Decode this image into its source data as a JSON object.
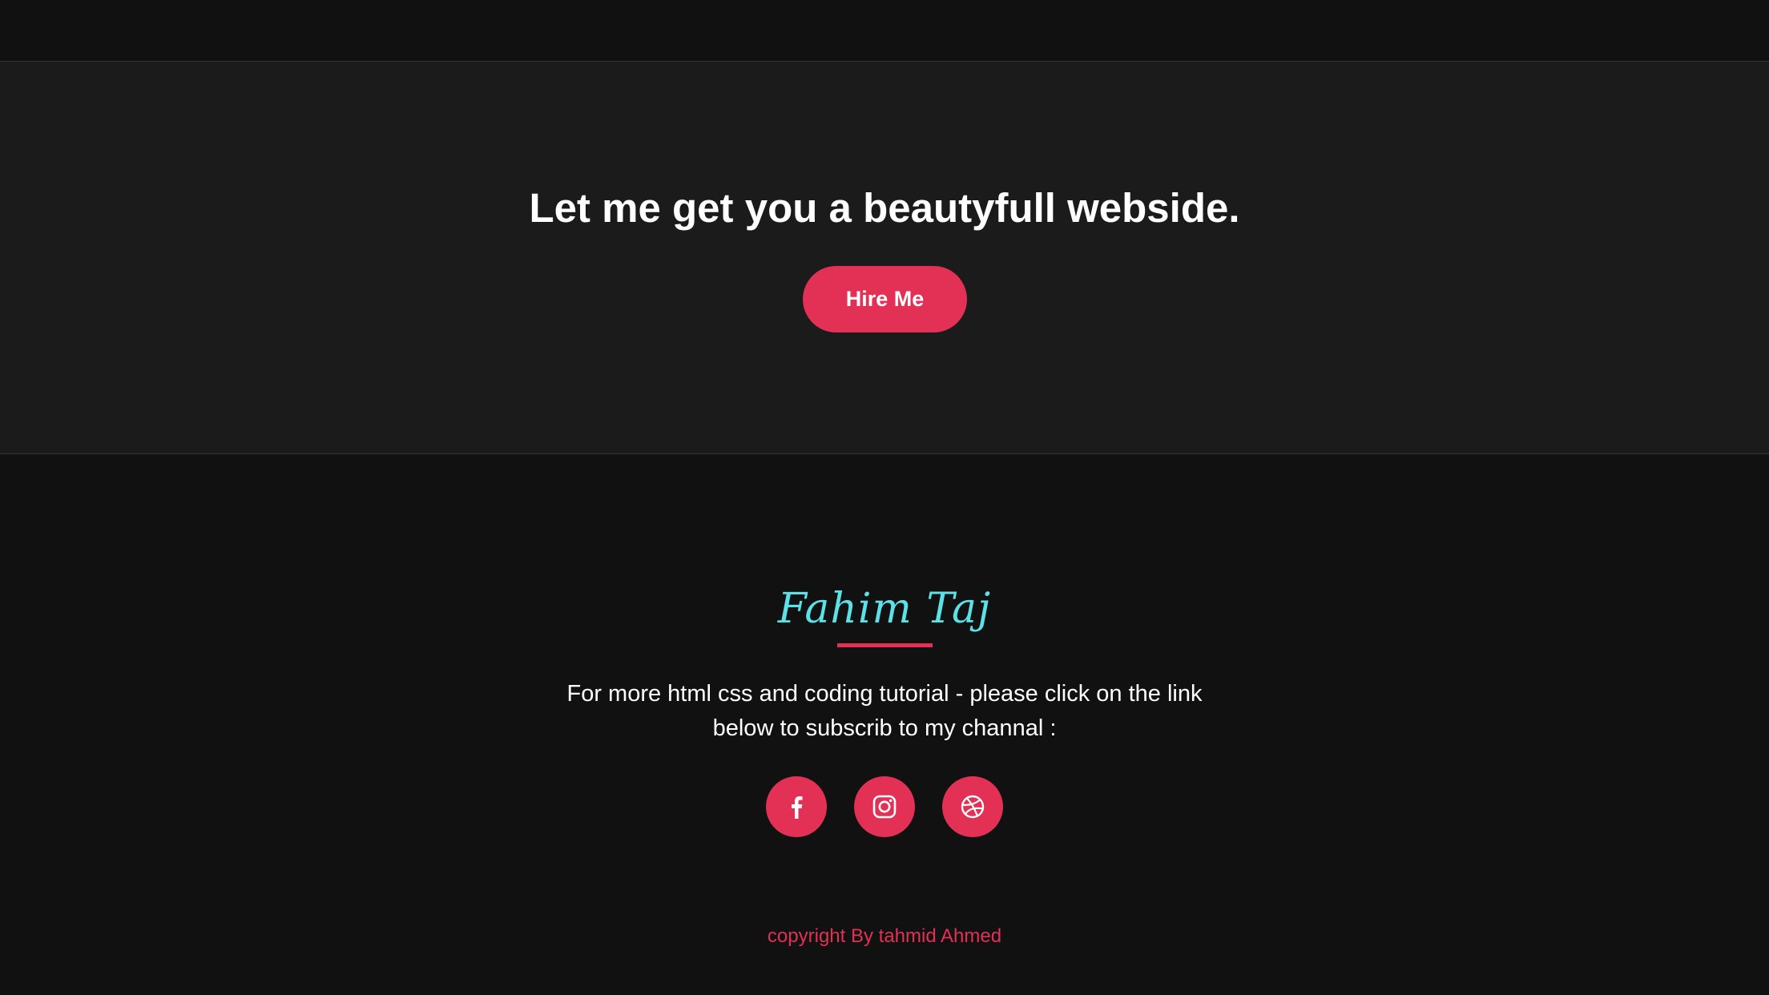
{
  "hero": {
    "title": "Let me get you a beautyfull webside.",
    "button_label": "Hire Me"
  },
  "footer": {
    "signature": "Fahim Taj",
    "description": "For more html css and coding tutorial - please click on the link below to subscrib to my channal :",
    "social_links": [
      {
        "name": "facebook",
        "icon": "facebook-icon"
      },
      {
        "name": "instagram",
        "icon": "instagram-icon"
      },
      {
        "name": "dribbble",
        "icon": "dribbble-icon"
      }
    ],
    "copyright": "copyright By tahmid Ahmed"
  },
  "colors": {
    "accent": "#e33055",
    "signature": "#5ce1e6",
    "hero_bg": "#1b1b1b",
    "page_bg": "#111111",
    "text": "#ffffff"
  }
}
